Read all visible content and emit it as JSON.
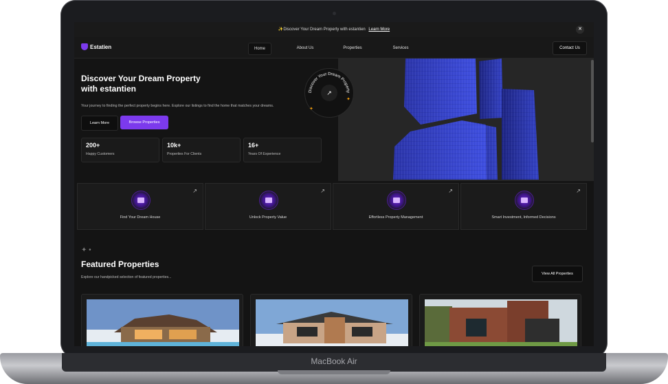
{
  "device": {
    "label": "MacBook Air"
  },
  "announcement": {
    "text": "✨Discover Your Dream Property with estantien",
    "link": "Learn More",
    "close": "✕"
  },
  "nav": {
    "brand": "Estatien",
    "items": [
      "Home",
      "About Us",
      "Properties",
      "Services"
    ],
    "active": "Home",
    "contact": "Contact Us"
  },
  "hero": {
    "title": "Discover Your Dream Property with estantien",
    "subtitle": "Your journey to finding the perfect property begins here. Explore our listings to find the home that matches your dreams.",
    "learn_more": "Learn More",
    "browse": "Browse Properties",
    "badge_text": "Discover Your Dream Property",
    "stats": [
      {
        "value": "200+",
        "label": "Happy Customers"
      },
      {
        "value": "10k+",
        "label": "Properties For Clients"
      },
      {
        "value": "16+",
        "label": "Years Of Experience"
      }
    ]
  },
  "features": [
    {
      "label": "Find Your Dream House",
      "icon": "home-icon"
    },
    {
      "label": "Unlock Property Value",
      "icon": "camera-icon"
    },
    {
      "label": "Effortless Property Management",
      "icon": "building-icon"
    },
    {
      "label": "Smart Investment, Informed Decisions",
      "icon": "sun-icon"
    }
  ],
  "featured": {
    "title": "Featured Properties",
    "subtitle": "Explore our handpicked selection of featured properties...",
    "view_all": "View All Properties"
  },
  "colors": {
    "accent": "#7c3aed",
    "bg": "#141414",
    "card": "#1b1b1b"
  }
}
